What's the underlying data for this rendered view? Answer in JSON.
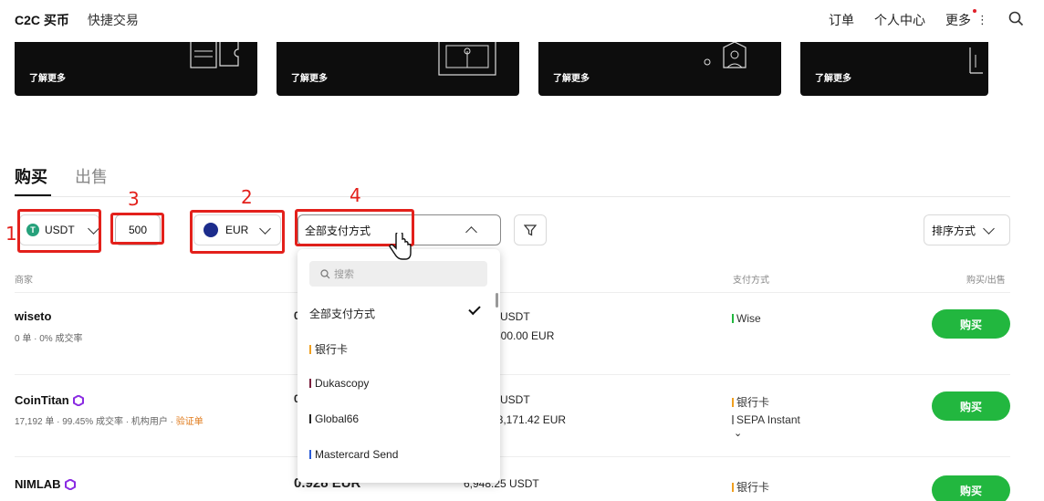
{
  "nav": {
    "brand": "C2C 买币",
    "quick": "快捷交易",
    "orders": "订单",
    "profile": "个人中心",
    "more": "更多",
    "more_kebab": "⋮"
  },
  "banners": [
    {
      "learn": "了解更多"
    },
    {
      "learn": "了解更多"
    },
    {
      "learn": "了解更多"
    },
    {
      "learn": "了解更多"
    }
  ],
  "tabs": {
    "buy": "购买",
    "sell": "出售"
  },
  "filters": {
    "coin": "USDT",
    "coin_icon_letter": "T",
    "amount": "500",
    "fiat": "EUR",
    "payment": "全部支付方式",
    "sort": "排序方式"
  },
  "annotations": {
    "n1": "1",
    "n2": "2",
    "n3": "3",
    "n4": "4"
  },
  "table_header": {
    "merchant": "商家",
    "payment_methods": "支付方式",
    "action": "购买/出售"
  },
  "rows": [
    {
      "name": "wiseto",
      "meta": "0 单 · 0% 成交率",
      "price": "0",
      "avail": "5 USDT",
      "limit": "-500.00 EUR",
      "payments": [
        {
          "label": "Wise",
          "color": "#22b73f"
        }
      ],
      "buy": "购买"
    },
    {
      "name": "CoinTitan",
      "meta": "17,192 单 · 99.45% 成交率 · 机构用户 · ",
      "verify": "验证单",
      "price": "0",
      "avail": "0 USDT",
      "limit": "48,171.42 EUR",
      "payments": [
        {
          "label": "银行卡",
          "color": "#f0a020"
        },
        {
          "label": "SEPA Instant",
          "color": "#888888"
        }
      ],
      "more_arrow": "⌄",
      "buy": "购买"
    },
    {
      "name": "NIMLAB",
      "price": "0.928 EUR",
      "avail": "6,948.25 USDT",
      "payments": [
        {
          "label": "银行卡",
          "color": "#f0a020"
        }
      ],
      "buy": "购买"
    }
  ],
  "dropdown": {
    "search_placeholder": "搜索",
    "items": [
      {
        "label": "全部支付方式",
        "selected": true
      },
      {
        "label": "银行卡",
        "color": "#f0a020"
      },
      {
        "label": "Dukascopy",
        "color": "#7a1f3d"
      },
      {
        "label": "Global66",
        "color": "#222222"
      },
      {
        "label": "Mastercard Send",
        "color": "#2a5bd7"
      }
    ]
  },
  "colors": {
    "accent_green": "#22b73f",
    "annotation_red": "#e3201b"
  }
}
